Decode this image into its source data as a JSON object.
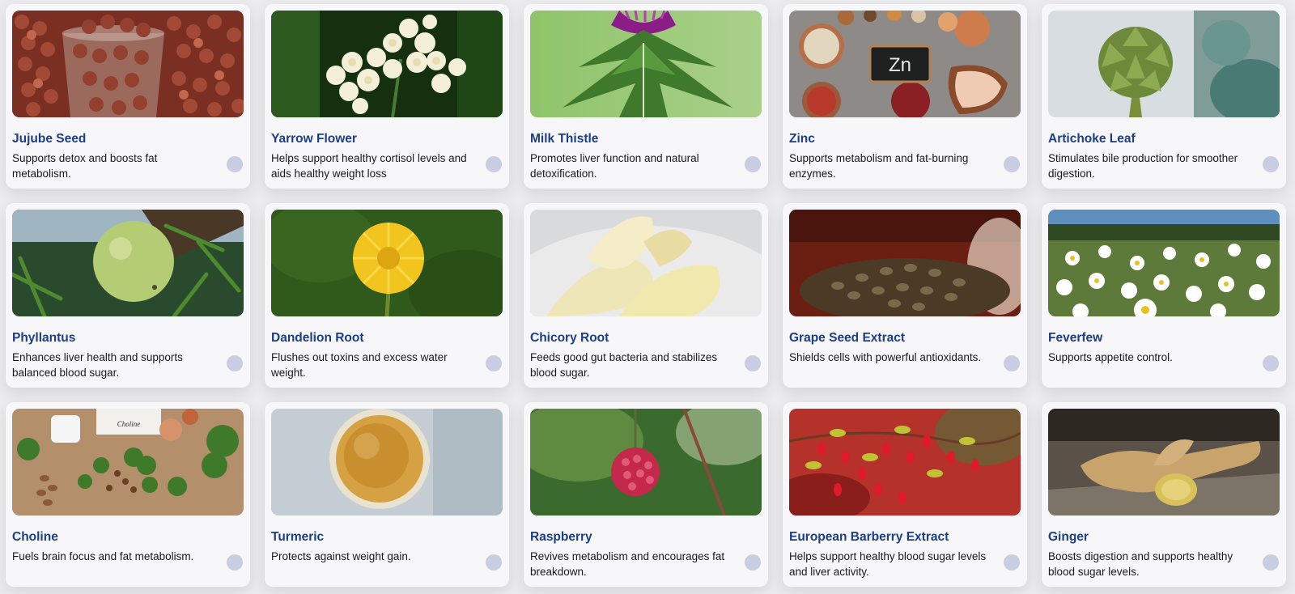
{
  "cards": [
    {
      "title": "Jujube Seed",
      "desc": "Supports detox and boosts fat metabolism.",
      "image": "jujube-seeds-photo"
    },
    {
      "title": "Yarrow Flower",
      "desc": "Helps support healthy cortisol levels and aids healthy weight loss",
      "image": "yarrow-flower-photo"
    },
    {
      "title": "Milk Thistle",
      "desc": "Promotes liver function and natural detoxification.",
      "image": "milk-thistle-photo"
    },
    {
      "title": "Zinc",
      "desc": "Supports metabolism and fat-burning enzymes.",
      "image": "zinc-foods-photo",
      "board_text": "Zn"
    },
    {
      "title": "Artichoke Leaf",
      "desc": "Stimulates bile production for smoother digestion.",
      "image": "artichoke-photo"
    },
    {
      "title": "Phyllantus",
      "desc": "Enhances liver health and supports balanced blood sugar.",
      "image": "phyllantus-fruit-photo"
    },
    {
      "title": "Dandelion Root",
      "desc": "Flushes out toxins and excess water weight.",
      "image": "dandelion-photo"
    },
    {
      "title": "Chicory Root",
      "desc": "Feeds good gut bacteria and stabilizes blood sugar.",
      "image": "chicory-photo"
    },
    {
      "title": "Grape Seed Extract",
      "desc": "Shields cells with powerful antioxidants.",
      "image": "grape-seeds-photo"
    },
    {
      "title": "Feverfew",
      "desc": "Supports appetite control.",
      "image": "feverfew-flowers-photo"
    },
    {
      "title": "Choline",
      "desc": "Fuels brain focus and fat metabolism.",
      "image": "choline-foods-photo",
      "board_text": "Choline"
    },
    {
      "title": "Turmeric",
      "desc": "Protects against weight gain.",
      "image": "turmeric-powder-photo"
    },
    {
      "title": "Raspberry",
      "desc": "Revives metabolism and encourages fat breakdown.",
      "image": "raspberry-photo"
    },
    {
      "title": "European Barberry Extract",
      "desc": "Helps support healthy blood sugar levels and liver activity.",
      "image": "barberry-photo"
    },
    {
      "title": "Ginger",
      "desc": "Boosts digestion and supports healthy blood sugar levels.",
      "image": "ginger-root-photo"
    }
  ],
  "colors": {
    "title": "#1c3e86",
    "dot": "#c9cde2",
    "card_bg": "#f7f7f9",
    "page_bg": "#ececee"
  }
}
